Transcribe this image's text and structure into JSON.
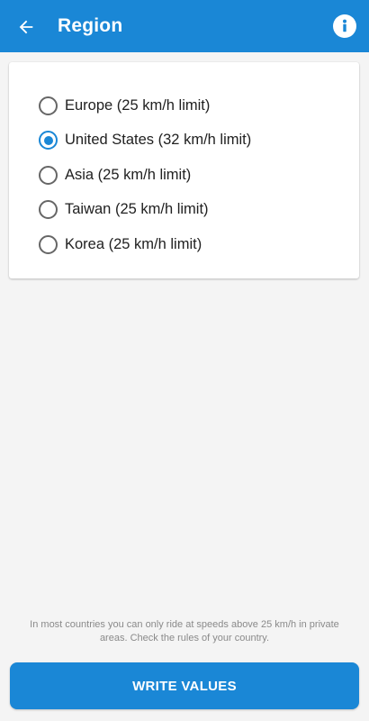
{
  "app_bar": {
    "title": "Region",
    "back_icon": "arrow-left-icon",
    "info_icon": "info-icon",
    "color": "#1a87d6"
  },
  "region_options": [
    {
      "label": "Europe (25 km/h limit)",
      "selected": false
    },
    {
      "label": "United States (32 km/h limit)",
      "selected": true
    },
    {
      "label": "Asia (25 km/h limit)",
      "selected": false
    },
    {
      "label": "Taiwan (25 km/h limit)",
      "selected": false
    },
    {
      "label": "Korea (25 km/h limit)",
      "selected": false
    }
  ],
  "footer_note": "In most countries you can only ride at speeds above 25 km/h in private areas. Check the rules of your country.",
  "write_button": {
    "label": "WRITE VALUES"
  }
}
